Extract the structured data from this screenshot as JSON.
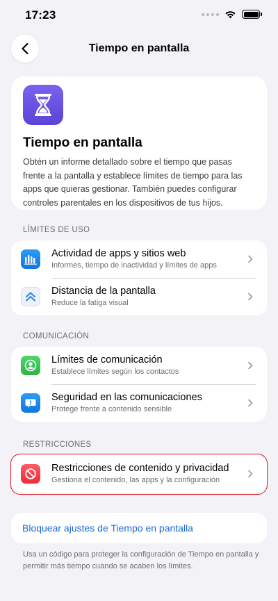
{
  "status_bar": {
    "time": "17:23"
  },
  "nav": {
    "title": "Tiempo en pantalla"
  },
  "hero": {
    "title": "Tiempo en pantalla",
    "description": "Obtén un informe detallado sobre el tiempo que pasas frente a la pantalla y establece límites de tiempo para las apps que quieras gestionar. También puedes configurar controles parentales en los dispositivos de tus hijos."
  },
  "sections": {
    "usage": {
      "header": "LÍMITES DE USO",
      "items": [
        {
          "title": "Actividad de apps y sitios web",
          "subtitle": "Informes, tiempo de inactividad y límites de apps",
          "icon": "bar-chart-icon",
          "color": "#1a84e8"
        },
        {
          "title": "Distancia de la pantalla",
          "subtitle": "Reduce la fatiga visual",
          "icon": "double-chevron-up-icon",
          "color": "#2f7fe0"
        }
      ]
    },
    "communication": {
      "header": "COMUNICACIÓN",
      "items": [
        {
          "title": "Límites de comunicación",
          "subtitle": "Establece límites según los contactos",
          "icon": "person-icon",
          "color": "#34c759"
        },
        {
          "title": "Seguridad en las comunicaciones",
          "subtitle": "Protege frente a contenido sensible",
          "icon": "chat-alert-icon",
          "color": "#1a84e8"
        }
      ]
    },
    "restrictions": {
      "header": "RESTRICCIONES",
      "items": [
        {
          "title": "Restricciones de contenido y privacidad",
          "subtitle": "Gestiona el contenido, las apps y la configuración",
          "icon": "prohibited-icon",
          "color": "#ff3b47"
        }
      ]
    }
  },
  "lock": {
    "link": "Bloquear ajustes de Tiempo en pantalla",
    "note": "Usa un código para proteger la configuración de Tiempo en pantalla y permitir más tiempo cuando se acaben los límites."
  }
}
